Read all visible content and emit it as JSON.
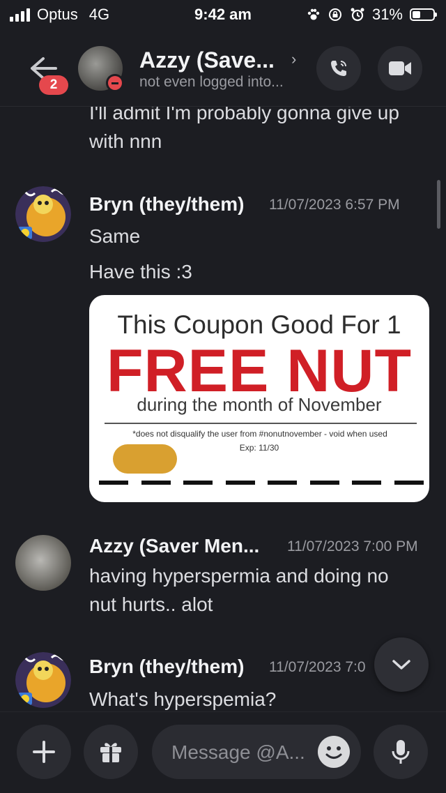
{
  "status_bar": {
    "carrier": "Optus",
    "network": "4G",
    "time": "9:42 am",
    "battery": "31%"
  },
  "header": {
    "back_badge": "2",
    "title": "Azzy (Save...",
    "subtitle": "not even logged into..."
  },
  "messages": [
    {
      "id": "prev",
      "lines": [
        "I'll admit I'm probably gonna give up",
        "with nnn"
      ]
    },
    {
      "id": "bryn1",
      "author": "Bryn (they/them)",
      "timestamp": "11/07/2023 6:57 PM",
      "lines": [
        "Same",
        "Have this :3"
      ]
    },
    {
      "id": "azzy1",
      "author": "Azzy (Saver Men...",
      "timestamp": "11/07/2023 7:00 PM",
      "lines": [
        "having hyperspermia and doing no",
        "nut hurts.. alot"
      ]
    },
    {
      "id": "bryn2",
      "author": "Bryn (they/them)",
      "timestamp": "11/07/2023 7:0",
      "lines": [
        "What's hyperspemia?"
      ]
    }
  ],
  "coupon": {
    "line1": "This Coupon Good For 1",
    "line2": "FREE NUT",
    "line3": "during the month of November",
    "fineprint": "*does not disqualify the user from #nonutnovember - void when used",
    "expiry": "Exp: 11/30"
  },
  "composer": {
    "placeholder": "Message @A..."
  },
  "colors": {
    "background": "#1c1d22",
    "badge": "#e5484d",
    "coupon_red": "#d01f26"
  },
  "icons": [
    "signal-icon",
    "paw-icon",
    "rotation-lock-icon",
    "alarm-icon",
    "battery-icon",
    "back-arrow-icon",
    "chevron-right-icon",
    "phone-icon",
    "video-icon",
    "chevron-down-icon",
    "plus-icon",
    "gift-icon",
    "emoji-icon",
    "microphone-icon"
  ]
}
